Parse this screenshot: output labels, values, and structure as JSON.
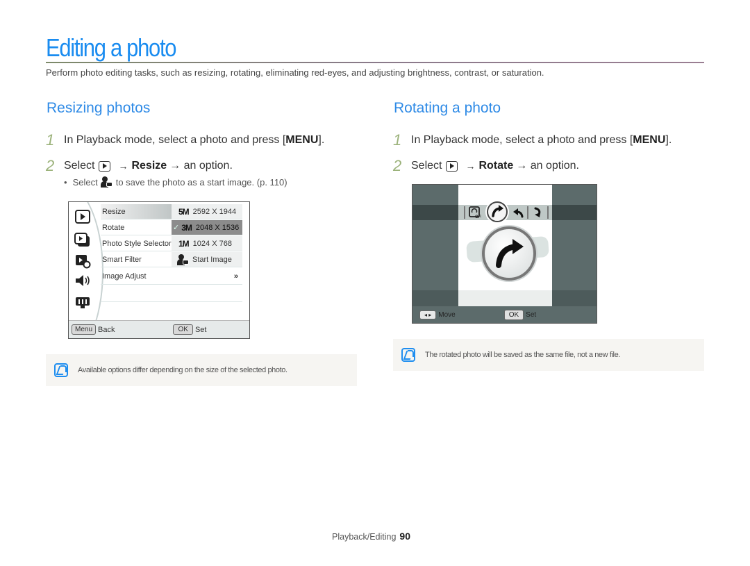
{
  "page": {
    "title": "Editing a photo",
    "intro": "Perform photo editing tasks, such as resizing, rotating, eliminating red-eyes, and adjusting brightness, contrast, or saturation.",
    "accent_color": "#1a8cf0",
    "footer": {
      "section": "Playback/Editing",
      "page_number": "90"
    }
  },
  "resizing": {
    "heading": "Resizing photos",
    "steps": [
      {
        "num": "1",
        "text": "In Playback mode, select a photo and press [",
        "key": "MENU",
        "after": "]."
      },
      {
        "num": "2",
        "pre": "Select",
        "icon": "playback-icon",
        "arrow": "→",
        "bold": "Resize",
        "post": "→ an option."
      }
    ],
    "bullet": {
      "pre": "Select",
      "icon": "start-image-icon",
      "post": "to save the photo as a start image. (p. 110)"
    },
    "camera_menu": {
      "side_icons": [
        "playback-icon",
        "slideshow-icon",
        "edit-effect-icon",
        "sound-icon",
        "display-icon"
      ],
      "rows": [
        {
          "label": "Resize",
          "option_icon": "5M",
          "option": "2592 X 1944",
          "state": "highlight"
        },
        {
          "label": "Rotate",
          "option_icon": "3M",
          "option": "2048 X 1536",
          "state": "selected",
          "check": "✓"
        },
        {
          "label": "Photo Style Selector",
          "option_icon": "1M",
          "option": "1024 X 768"
        },
        {
          "label": "Smart Filter",
          "option_icon": "start-image",
          "option": "Start Image"
        },
        {
          "label": "Image Adjust",
          "option": "»"
        }
      ],
      "bottom": {
        "back_key": "Menu",
        "back_label": "Back",
        "ok_key": "OK",
        "ok_label": "Set"
      }
    },
    "note": "Available options differ depending on the size of the selected photo."
  },
  "rotating": {
    "heading": "Rotating a photo",
    "steps": [
      {
        "num": "1",
        "text": "In Playback mode, select a photo and press [",
        "key": "MENU",
        "after": "]."
      },
      {
        "num": "2",
        "pre": "Select",
        "icon": "playback-icon",
        "arrow": "→",
        "bold": "Rotate",
        "post": "→ an option."
      }
    ],
    "camera_screen": {
      "options": [
        "rotate-off-icon",
        "rotate-right-icon",
        "rotate-left-icon",
        "rotate-180-icon"
      ],
      "selected": "rotate-right-icon",
      "bottom": {
        "move_key": "◂ ▸",
        "move_label": "Move",
        "ok_key": "OK",
        "ok_label": "Set"
      }
    },
    "note": "The rotated photo will be saved as the same file, not a new file."
  }
}
